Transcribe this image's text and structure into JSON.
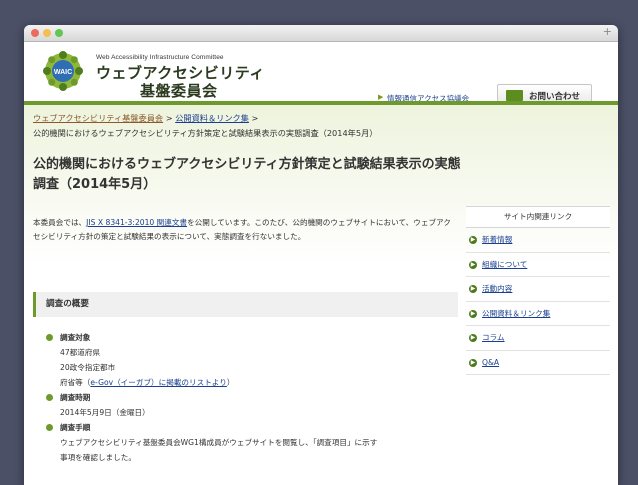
{
  "window": {
    "plus": "+"
  },
  "header": {
    "logo_badge": "WAIC",
    "org_en": "Web Accessibility Infrastructure Committee",
    "org_ja_line1": "ウェブアクセシビリティ",
    "org_ja_line2": "基盤委員会",
    "link": "情報通信アクセス協議会",
    "contact_button": "お問い合わせ"
  },
  "breadcrumb": {
    "home": "ウェブアクセシビリティ基盤委員会",
    "sep1": " > ",
    "section": "公開資料＆リンク集",
    "sep2": " > ",
    "current": "公的機関におけるウェブアクセシビリティ方針策定と試験結果表示の実態調査（2014年5月）"
  },
  "page_title": "公的機関におけるウェブアクセシビリティ方針策定と試験結果表示の実態調査（2014年5月）",
  "intro": {
    "before": "本委員会では、",
    "link": "JIS X 8341-3:2010 関連文書",
    "after": "を公開しています。このたび、公的機関のウェブサイトにおいて、ウェブアクセシビリティ方針の策定と試験結果の表示について、実態調査を行ないました。"
  },
  "sidebar": {
    "title": "サイト内関連リンク",
    "items": [
      {
        "label": "新着情報"
      },
      {
        "label": "組織について"
      },
      {
        "label": "活動内容"
      },
      {
        "label": "公開資料＆リンク集"
      },
      {
        "label": "コラム"
      },
      {
        "label": "Q&A"
      }
    ]
  },
  "overview": {
    "heading": "調査の概要",
    "target_label": "調査対象",
    "target_items": [
      "47都道府県",
      "20政令指定都市"
    ],
    "target_3_before": "府省等（",
    "target_3_link": "e-Gov（イーガブ）に掲載のリストより",
    "target_3_after": "）",
    "time_label": "調査時期",
    "time_value": "2014年5月9日（金曜日）",
    "method_label": "調査手順",
    "method_line1": "ウェブアクセシビリティ基盤委員会WG1構成員がウェブサイトを閲覧し、「調査項目」に示す",
    "method_line2": "事項を確認しました。"
  }
}
